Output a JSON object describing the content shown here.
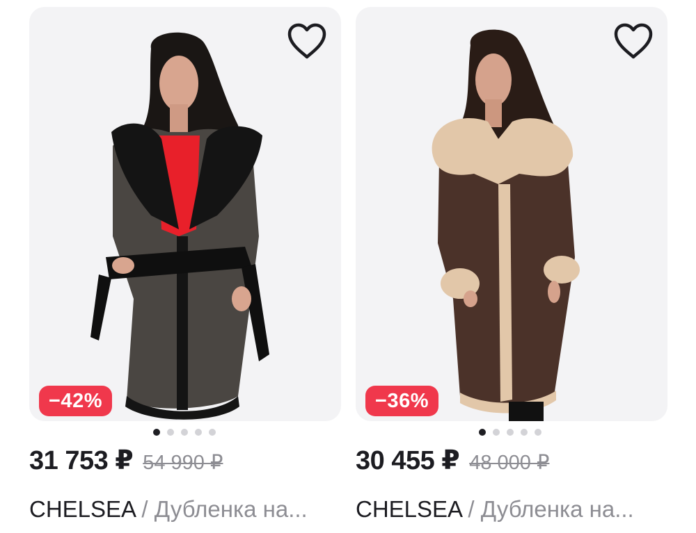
{
  "products": [
    {
      "discount": "−42%",
      "price": "31 753 ₽",
      "old_price": "54 990 ₽",
      "brand": "CHELSEA",
      "separator": " / ",
      "name": "Дубленка на...",
      "photo_dots": 5,
      "active_photo": 1,
      "favorite_icon": "heart-outline-icon",
      "colors": {
        "coat": "#4a4642",
        "fur": "#141414",
        "top": "#e8202a"
      }
    },
    {
      "discount": "−36%",
      "price": "30 455 ₽",
      "old_price": "48 000 ₽",
      "brand": "CHELSEA",
      "separator": " / ",
      "name": "Дубленка на...",
      "photo_dots": 5,
      "active_photo": 1,
      "favorite_icon": "heart-outline-icon",
      "colors": {
        "coat": "#4b3229",
        "fur": "#e2c7a9",
        "top": "#2b211c"
      }
    }
  ],
  "theme": {
    "badge_color": "#f0384c",
    "card_background": "#f3f3f5",
    "text_primary": "#1c1c21",
    "text_secondary": "#8d8d93"
  }
}
